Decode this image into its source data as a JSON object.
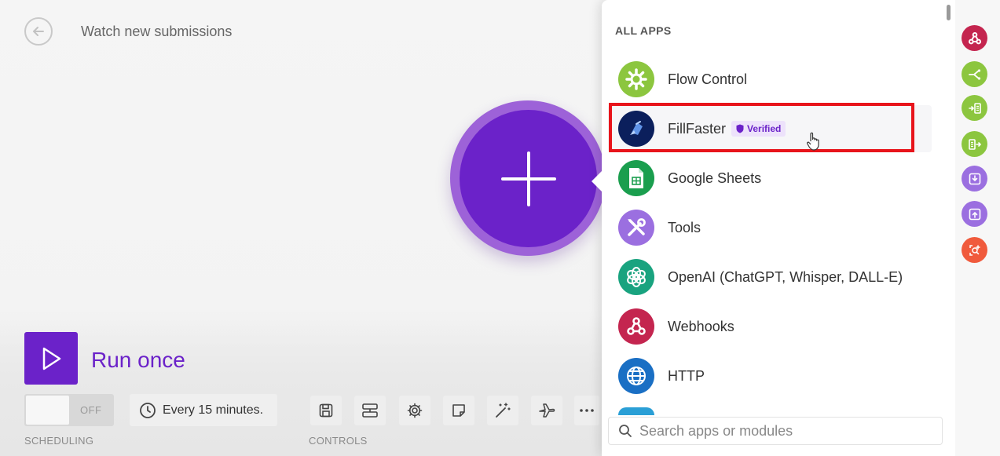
{
  "header": {
    "scenario_title": "Watch new submissions"
  },
  "run": {
    "label": "Run once"
  },
  "scheduling": {
    "toggle_label": "OFF",
    "interval": "Every 15 minutes.",
    "section_label": "SCHEDULING"
  },
  "controls": {
    "section_label": "CONTROLS",
    "items": [
      "save-icon",
      "align-icon",
      "gear-icon",
      "note-icon",
      "magic-wand-icon",
      "airplane-icon",
      "more-icon"
    ]
  },
  "app_picker": {
    "heading": "ALL APPS",
    "apps": [
      {
        "name": "Flow Control",
        "icon": "gear-icon",
        "color": "#8cc63f"
      },
      {
        "name": "FillFaster",
        "badge": "Verified",
        "icon": "fillfaster-logo",
        "color": "#0b1f5c"
      },
      {
        "name": "Google Sheets",
        "icon": "spreadsheet-icon",
        "color": "#1a9e4e"
      },
      {
        "name": "Tools",
        "icon": "tools-icon",
        "color": "#9b6fe0"
      },
      {
        "name": "OpenAI (ChatGPT, Whisper, DALL-E)",
        "icon": "openai-icon",
        "color": "#19a37f"
      },
      {
        "name": "Webhooks",
        "icon": "webhook-icon",
        "color": "#c4254f"
      },
      {
        "name": "HTTP",
        "icon": "globe-icon",
        "color": "#1a6fc4"
      }
    ],
    "search_placeholder": "Search apps or modules"
  },
  "rail": {
    "buttons": [
      {
        "icon": "webhook-icon",
        "color": "#c4254f"
      },
      {
        "icon": "router-icon",
        "color": "#8cc63f"
      },
      {
        "icon": "iterator-icon",
        "color": "#8cc63f"
      },
      {
        "icon": "aggregator-icon",
        "color": "#8cc63f"
      },
      {
        "icon": "download-icon",
        "color": "#9b6fe0"
      },
      {
        "icon": "upload-icon",
        "color": "#9b6fe0"
      },
      {
        "icon": "search-plus-icon",
        "color": "#f05a3c"
      }
    ]
  },
  "colors": {
    "brand": "#6b22c9",
    "highlight": "#e8141b"
  }
}
